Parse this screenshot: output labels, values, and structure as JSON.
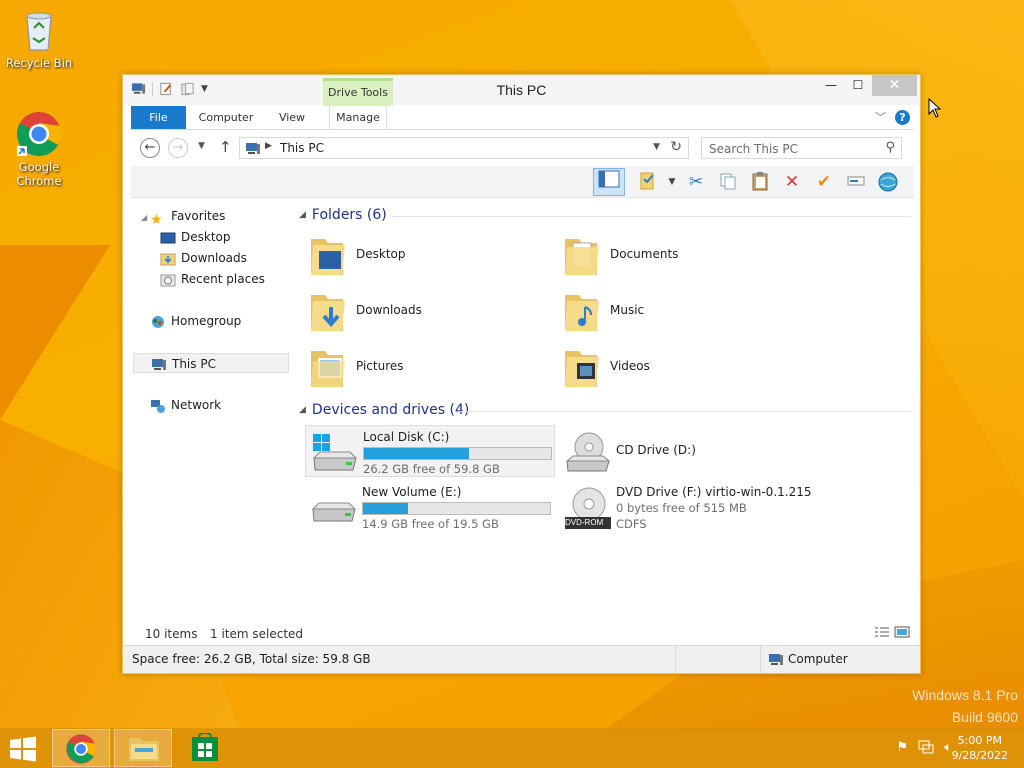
{
  "desktop": {
    "icons": [
      {
        "label": "Recycle Bin"
      },
      {
        "label": "Google Chrome"
      }
    ],
    "watermark": [
      "Windows 8.1 Pro",
      "Build 9600"
    ]
  },
  "window": {
    "title": "This PC",
    "context_tab": "Drive Tools",
    "ribbon_tabs": [
      "File",
      "Computer",
      "View",
      "Manage"
    ],
    "address": "This PC",
    "search_placeholder": "Search This PC"
  },
  "sidebar": {
    "favorites": "Favorites",
    "favorite_items": [
      "Desktop",
      "Downloads",
      "Recent places"
    ],
    "homegroup": "Homegroup",
    "this_pc": "This PC",
    "network": "Network"
  },
  "content": {
    "folders_header": "Folders (6)",
    "folders": [
      "Desktop",
      "Documents",
      "Downloads",
      "Music",
      "Pictures",
      "Videos"
    ],
    "drives_header": "Devices and drives (4)",
    "drives": [
      {
        "name": "Local Disk (C:)",
        "status": "26.2 GB free of 59.8 GB",
        "used_fraction": 0.56
      },
      {
        "name": "CD Drive (D:)"
      },
      {
        "name": "New Volume (E:)",
        "status": "14.9 GB free of 19.5 GB",
        "used_fraction": 0.24
      },
      {
        "name": "DVD Drive (F:) virtio-win-0.1.215",
        "status": "0 bytes free of 515 MB",
        "fs": "CDFS",
        "badge": "DVD-ROM"
      }
    ]
  },
  "status": {
    "items": "10 items",
    "selected": "1 item selected",
    "space": "Space free: 26.2 GB, Total size: 59.8 GB",
    "location": "Computer"
  },
  "taskbar": {
    "time": "5:00 PM",
    "date": "9/28/2022"
  },
  "colors": {
    "accent": "#1979ca",
    "progress": "#26a0da",
    "desktop": "#f6a800"
  }
}
